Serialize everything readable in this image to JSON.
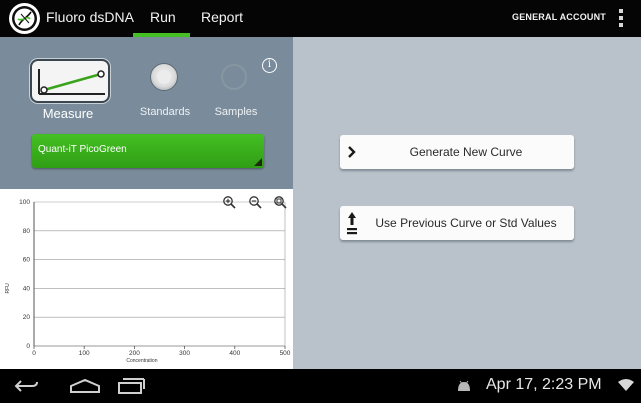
{
  "app": {
    "title": "Fluoro dsDNA"
  },
  "tabs": [
    {
      "label": "Run",
      "active": true
    },
    {
      "label": "Report",
      "active": false
    }
  ],
  "account": "GENERAL ACCOUNT",
  "controls": {
    "measure_label": "Measure",
    "standards_label": "Standards",
    "samples_label": "Samples",
    "info_glyph": "i",
    "dye_label": "Quant-iT PicoGreen"
  },
  "colors": {
    "accent_tab": "#33b5e5",
    "dye_green": "#44c024",
    "panel": "#7a8c9b",
    "background": "#b9c2ca"
  },
  "chart_data": {
    "type": "line",
    "series": [],
    "xlabel": "Concentration",
    "ylabel": "RFU",
    "xlim": [
      0,
      500
    ],
    "ylim": [
      0,
      100
    ],
    "xticks": [
      "0",
      "100",
      "200",
      "300",
      "400",
      "500"
    ],
    "yticks": [
      "0",
      "20",
      "40",
      "60",
      "80",
      "100"
    ],
    "grid": true
  },
  "actions": {
    "generate_label": "Generate New Curve",
    "previous_label": "Use Previous Curve or Std Values"
  },
  "statusbar": {
    "time": "Apr 17, 2:23 PM"
  },
  "icons": [
    "logo-icon",
    "overflow-menu-icon",
    "info-icon",
    "zoom-in-icon",
    "zoom-out-icon",
    "zoom-reset-icon",
    "chevron-right-icon",
    "upload-icon",
    "back-icon",
    "home-icon",
    "recent-apps-icon",
    "android-icon",
    "wifi-icon"
  ]
}
